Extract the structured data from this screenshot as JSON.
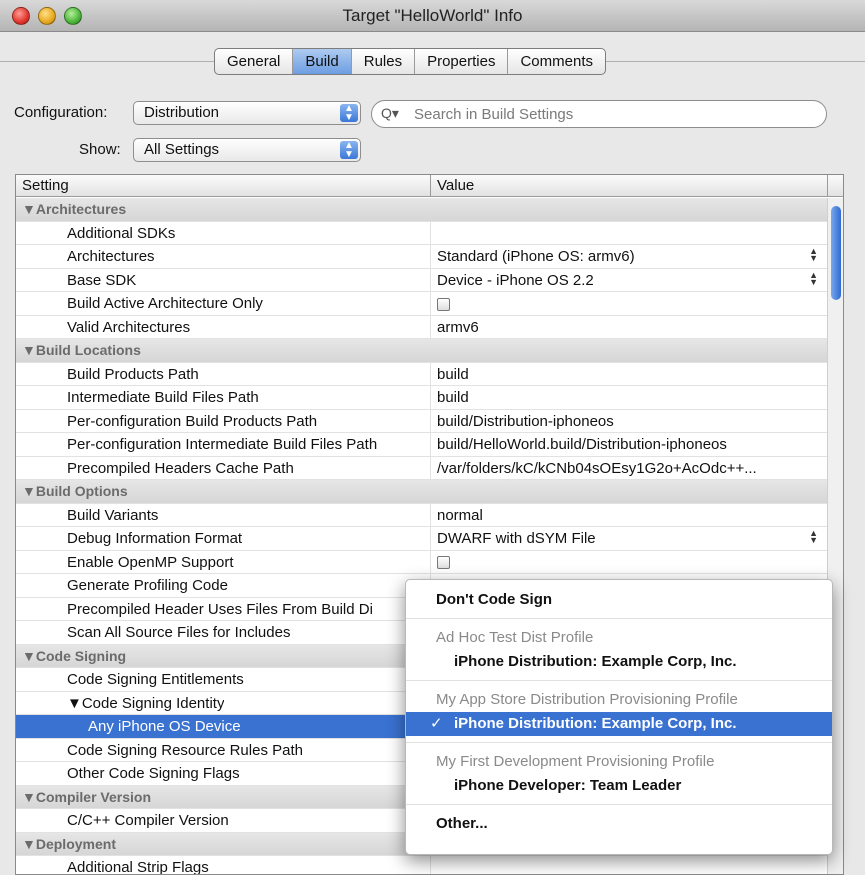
{
  "window": {
    "title": "Target \"HelloWorld\" Info"
  },
  "tabs": [
    "General",
    "Build",
    "Rules",
    "Properties",
    "Comments"
  ],
  "active_tab": "Build",
  "configuration": {
    "label": "Configuration:",
    "value": "Distribution"
  },
  "show": {
    "label": "Show:",
    "value": "All Settings"
  },
  "search": {
    "placeholder": "Search in Build Settings"
  },
  "table": {
    "col_setting": "Setting",
    "col_value": "Value",
    "rows": [
      {
        "type": "group",
        "name": "▼Architectures"
      },
      {
        "type": "item",
        "name": "Additional SDKs",
        "value": ""
      },
      {
        "type": "item",
        "name": "Architectures",
        "value": "Standard (iPhone OS: armv6)",
        "stepper": true
      },
      {
        "type": "item",
        "name": "Base SDK",
        "value": "Device - iPhone OS 2.2",
        "stepper": true
      },
      {
        "type": "item",
        "name": "Build Active Architecture Only",
        "value": "",
        "checkbox": true
      },
      {
        "type": "item",
        "name": "Valid Architectures",
        "value": "armv6"
      },
      {
        "type": "group",
        "name": "▼Build Locations"
      },
      {
        "type": "item",
        "name": "Build Products Path",
        "value": "build"
      },
      {
        "type": "item",
        "name": "Intermediate Build Files Path",
        "value": "build"
      },
      {
        "type": "item",
        "name": "Per-configuration Build Products Path",
        "value": "build/Distribution-iphoneos"
      },
      {
        "type": "item",
        "name": "Per-configuration Intermediate Build Files Path",
        "value": "build/HelloWorld.build/Distribution-iphoneos"
      },
      {
        "type": "item",
        "name": "Precompiled Headers Cache Path",
        "value": "/var/folders/kC/kCNb04sOEsy1G2o+AcOdc++..."
      },
      {
        "type": "group",
        "name": "▼Build Options"
      },
      {
        "type": "item",
        "name": "Build Variants",
        "value": "normal"
      },
      {
        "type": "item",
        "name": "Debug Information Format",
        "value": "DWARF with dSYM File",
        "stepper": true
      },
      {
        "type": "item",
        "name": "Enable OpenMP Support",
        "value": "",
        "checkbox": true
      },
      {
        "type": "item",
        "name": "Generate Profiling Code",
        "value": "",
        "checkbox": true
      },
      {
        "type": "item",
        "name": "Precompiled Header Uses Files From Build Di",
        "value": ""
      },
      {
        "type": "item",
        "name": "Scan All Source Files for Includes",
        "value": ""
      },
      {
        "type": "group",
        "name": "▼Code Signing"
      },
      {
        "type": "item",
        "name": "Code Signing Entitlements",
        "value": ""
      },
      {
        "type": "item",
        "name": "▼Code Signing Identity",
        "value": "",
        "indent": 2
      },
      {
        "type": "item",
        "name": "Any iPhone OS Device",
        "value": "",
        "indent": 3,
        "selected": true
      },
      {
        "type": "item",
        "name": "Code Signing Resource Rules Path",
        "value": ""
      },
      {
        "type": "item",
        "name": "Other Code Signing Flags",
        "value": ""
      },
      {
        "type": "group",
        "name": "▼Compiler Version"
      },
      {
        "type": "item",
        "name": "C/C++ Compiler Version",
        "value": ""
      },
      {
        "type": "group",
        "name": "▼Deployment"
      },
      {
        "type": "item",
        "name": "Additional Strip Flags",
        "value": ""
      }
    ]
  },
  "menu": {
    "items": [
      {
        "kind": "bold",
        "label": "Don't Code Sign"
      },
      {
        "kind": "sep"
      },
      {
        "kind": "header",
        "label": "Ad Hoc Test Dist Profile"
      },
      {
        "kind": "bold",
        "label": "iPhone Distribution: Example Corp, Inc."
      },
      {
        "kind": "sep"
      },
      {
        "kind": "header",
        "label": "My App Store Distribution Provisioning Profile"
      },
      {
        "kind": "bold",
        "label": "iPhone Distribution: Example Corp, Inc.",
        "checked": true,
        "check": "✓"
      },
      {
        "kind": "sep"
      },
      {
        "kind": "header",
        "label": "My First Development Provisioning Profile"
      },
      {
        "kind": "bold",
        "label": "iPhone Developer: Team Leader"
      },
      {
        "kind": "sep"
      },
      {
        "kind": "bold",
        "label": "Other..."
      }
    ]
  }
}
